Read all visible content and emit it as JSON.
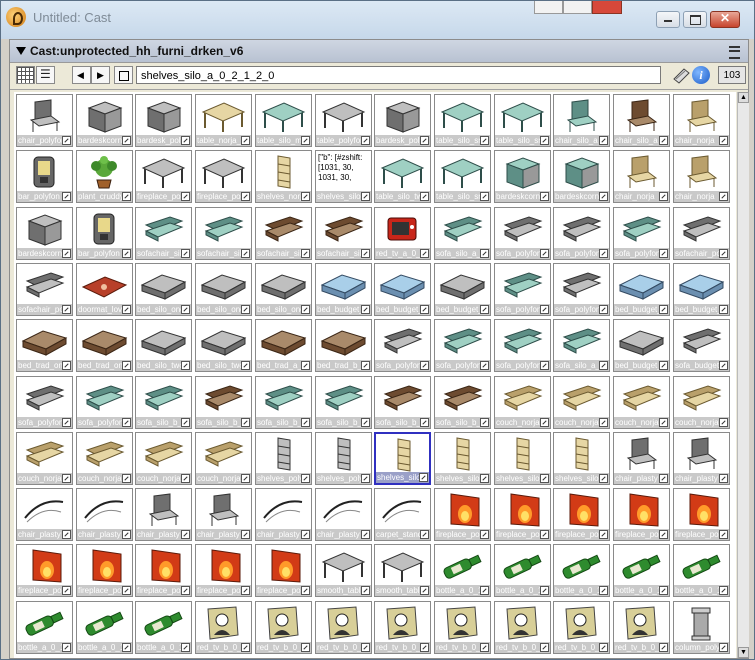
{
  "window": {
    "title": "Untitled: Cast"
  },
  "panel": {
    "title": "Cast:unprotected_hh_furni_drken_v6"
  },
  "toolbar": {
    "member_name": "shelves_silo_a_0_2_1_2_0",
    "member_number": "103"
  },
  "colors": {
    "accent": "#3030c0",
    "wood": "#c8a070",
    "fire": "#d23b16",
    "bottle": "#2e8b2e"
  },
  "cells": [
    {
      "label": "chair_polyfon",
      "icon": "chair-icon",
      "kind": "dark"
    },
    {
      "label": "bardeskcorne",
      "icon": "desk-icon",
      "kind": "dark"
    },
    {
      "label": "bardesk_poly",
      "icon": "desk-icon",
      "kind": "dark"
    },
    {
      "label": "table_norja_m",
      "icon": "table-icon",
      "kind": "wood"
    },
    {
      "label": "table_silo_me",
      "icon": "table-icon",
      "kind": "teal"
    },
    {
      "label": "table_polyfon",
      "icon": "table-icon",
      "kind": "dark"
    },
    {
      "label": "bardesk_polyf",
      "icon": "desk-icon",
      "kind": "dark"
    },
    {
      "label": "table_silo_sm",
      "icon": "table-icon",
      "kind": "teal"
    },
    {
      "label": "table_silo_sm",
      "icon": "table-icon",
      "kind": "teal"
    },
    {
      "label": "chair_silo_a",
      "icon": "chair-icon",
      "kind": "teal"
    },
    {
      "label": "chair_silo_a",
      "icon": "chair-icon",
      "kind": "brown"
    },
    {
      "label": "chair_norja",
      "icon": "chair-icon",
      "kind": "wood"
    },
    {
      "label": "bar_polyfon",
      "icon": "bar-machine-icon",
      "kind": "dark"
    },
    {
      "label": "plant_cruddy",
      "icon": "plant-icon",
      "kind": "plant"
    },
    {
      "label": "fireplace_poly",
      "icon": "fireplace-icon",
      "kind": "dark"
    },
    {
      "label": "fireplace_poly",
      "icon": "fireplace-icon",
      "kind": "dark"
    },
    {
      "label": "shelves_norja",
      "icon": "shelf-icon",
      "kind": "wood"
    },
    {
      "label": "shelves_silo_b",
      "icon": "text-icon",
      "kind": "text",
      "text": "[\"b\": [#zshift: [1031, 30, 1031, 30,"
    },
    {
      "label": "table_silo_two",
      "icon": "table-icon",
      "kind": "teal"
    },
    {
      "label": "table_silo_sm",
      "icon": "table-icon",
      "kind": "teal"
    },
    {
      "label": "bardeskcorne",
      "icon": "desk-icon",
      "kind": "teal"
    },
    {
      "label": "bardeskcorne",
      "icon": "desk-icon",
      "kind": "teal"
    },
    {
      "label": "chair_norja",
      "icon": "chair-icon",
      "kind": "wood"
    },
    {
      "label": "chair_norja",
      "icon": "chair-icon",
      "kind": "wood"
    },
    {
      "label": "bardeskcorne",
      "icon": "desk-icon",
      "kind": "dark"
    },
    {
      "label": "bar_polyfon",
      "icon": "bar-machine-icon",
      "kind": "dark"
    },
    {
      "label": "sofachair_sil",
      "icon": "sofa-icon",
      "kind": "teal"
    },
    {
      "label": "sofachair_sil",
      "icon": "sofa-icon",
      "kind": "teal"
    },
    {
      "label": "sofachair_sil",
      "icon": "sofa-icon",
      "kind": "brown"
    },
    {
      "label": "sofachair_sil",
      "icon": "sofa-icon",
      "kind": "brown"
    },
    {
      "label": "red_tv_a_0_1",
      "icon": "tv-icon",
      "kind": "red"
    },
    {
      "label": "sofa_silo_a_0",
      "icon": "sofa-icon",
      "kind": "teal"
    },
    {
      "label": "sofa_polyfon",
      "icon": "sofa-icon",
      "kind": "dark"
    },
    {
      "label": "sofa_polyfon",
      "icon": "sofa-icon",
      "kind": "dark"
    },
    {
      "label": "sofa_polyfon",
      "icon": "sofa-icon",
      "kind": "teal"
    },
    {
      "label": "sofachair_poly",
      "icon": "sofa-icon",
      "kind": "dark"
    },
    {
      "label": "sofachair_poly",
      "icon": "sofa-icon",
      "kind": "dark"
    },
    {
      "label": "doormat_love",
      "icon": "doormat-icon",
      "kind": "red"
    },
    {
      "label": "bed_silo_one",
      "icon": "bed-icon",
      "kind": "dark"
    },
    {
      "label": "bed_silo_one",
      "icon": "bed-icon",
      "kind": "dark"
    },
    {
      "label": "bed_silo_one",
      "icon": "bed-icon",
      "kind": "dark"
    },
    {
      "label": "bed_budget_o",
      "icon": "bed-icon",
      "kind": "blue"
    },
    {
      "label": "bed_budget_o",
      "icon": "bed-icon",
      "kind": "blue"
    },
    {
      "label": "bed_budget_o",
      "icon": "bed-icon",
      "kind": "dark"
    },
    {
      "label": "sofa_polyfon",
      "icon": "sofa-icon",
      "kind": "teal"
    },
    {
      "label": "sofa_polyfon",
      "icon": "sofa-icon",
      "kind": "dark"
    },
    {
      "label": "bed_budget_o",
      "icon": "bed-icon",
      "kind": "blue"
    },
    {
      "label": "bed_budget_o",
      "icon": "bed-icon",
      "kind": "blue"
    },
    {
      "label": "bed_trad_one",
      "icon": "bed-icon",
      "kind": "brown"
    },
    {
      "label": "bed_trad_one",
      "icon": "bed-icon",
      "kind": "brown"
    },
    {
      "label": "bed_silo_two",
      "icon": "bed-icon",
      "kind": "dark"
    },
    {
      "label": "bed_silo_two",
      "icon": "bed-icon",
      "kind": "dark"
    },
    {
      "label": "bed_trad_a_0",
      "icon": "bed-icon",
      "kind": "brown"
    },
    {
      "label": "bed_trad_b_0",
      "icon": "bed-icon",
      "kind": "brown"
    },
    {
      "label": "sofa_polyfon",
      "icon": "sofa-icon",
      "kind": "dark"
    },
    {
      "label": "sofa_polyfon",
      "icon": "sofa-icon",
      "kind": "teal"
    },
    {
      "label": "sofa_polyfon",
      "icon": "sofa-icon",
      "kind": "teal"
    },
    {
      "label": "sofa_silo_a_0",
      "icon": "sofa-icon",
      "kind": "teal"
    },
    {
      "label": "bed_budget_o",
      "icon": "bed-icon",
      "kind": "dark"
    },
    {
      "label": "sofa_budget_o",
      "icon": "sofa-icon",
      "kind": "dark"
    },
    {
      "label": "sofa_polyfon",
      "icon": "sofa-icon",
      "kind": "dark"
    },
    {
      "label": "sofa_polyfon",
      "icon": "sofa-icon",
      "kind": "teal"
    },
    {
      "label": "sofa_silo_b_0",
      "icon": "sofa-icon",
      "kind": "teal"
    },
    {
      "label": "sofa_silo_b_0",
      "icon": "sofa-icon",
      "kind": "brown"
    },
    {
      "label": "sofa_silo_b_0",
      "icon": "sofa-icon",
      "kind": "teal"
    },
    {
      "label": "sofa_silo_b_0",
      "icon": "sofa-icon",
      "kind": "teal"
    },
    {
      "label": "sofa_silo_b_0",
      "icon": "sofa-icon",
      "kind": "brown"
    },
    {
      "label": "sofa_silo_b_0",
      "icon": "sofa-icon",
      "kind": "brown"
    },
    {
      "label": "couch_norja",
      "icon": "couch-icon",
      "kind": "wood"
    },
    {
      "label": "couch_norja",
      "icon": "couch-icon",
      "kind": "wood"
    },
    {
      "label": "couch_norja",
      "icon": "couch-icon",
      "kind": "wood"
    },
    {
      "label": "couch_norja",
      "icon": "couch-icon",
      "kind": "wood"
    },
    {
      "label": "couch_norja",
      "icon": "couch-icon",
      "kind": "wood"
    },
    {
      "label": "couch_norja",
      "icon": "couch-icon",
      "kind": "wood"
    },
    {
      "label": "couch_norja",
      "icon": "couch-icon",
      "kind": "wood"
    },
    {
      "label": "couch_norja",
      "icon": "couch-icon",
      "kind": "wood"
    },
    {
      "label": "shelves_poly",
      "icon": "shelf-icon",
      "kind": "dark"
    },
    {
      "label": "shelves_poly",
      "icon": "shelf-icon",
      "kind": "dark"
    },
    {
      "label": "shelves_silo",
      "icon": "shelf-icon",
      "kind": "wood",
      "selected": true
    },
    {
      "label": "shelves_silo",
      "icon": "shelf-icon",
      "kind": "wood"
    },
    {
      "label": "shelves_silo",
      "icon": "shelf-icon",
      "kind": "wood"
    },
    {
      "label": "shelves_silo",
      "icon": "shelf-icon",
      "kind": "wood"
    },
    {
      "label": "chair_plasty",
      "icon": "chair-icon",
      "kind": "dark"
    },
    {
      "label": "chair_plasty",
      "icon": "chair-icon",
      "kind": "dark"
    },
    {
      "label": "chair_plasty",
      "icon": "chair-outline-icon",
      "kind": "outline"
    },
    {
      "label": "chair_plasty",
      "icon": "chair-outline-icon",
      "kind": "outline"
    },
    {
      "label": "chair_plasty",
      "icon": "chair-icon",
      "kind": "dark"
    },
    {
      "label": "chair_plasty",
      "icon": "chair-icon",
      "kind": "dark"
    },
    {
      "label": "chair_plasty",
      "icon": "chair-outline-icon",
      "kind": "outline"
    },
    {
      "label": "chair_plasty",
      "icon": "chair-outline-icon",
      "kind": "outline"
    },
    {
      "label": "carpet_standa",
      "icon": "carpet-icon",
      "kind": "outline"
    },
    {
      "label": "fireplace_poly",
      "icon": "fireplace-icon",
      "kind": "fire"
    },
    {
      "label": "fireplace_poly",
      "icon": "fireplace-icon",
      "kind": "fire"
    },
    {
      "label": "fireplace_poly",
      "icon": "fireplace-icon",
      "kind": "fire"
    },
    {
      "label": "fireplace_poly",
      "icon": "fireplace-icon",
      "kind": "fire"
    },
    {
      "label": "fireplace_poly",
      "icon": "fireplace-icon",
      "kind": "fire"
    },
    {
      "label": "fireplace_poly",
      "icon": "fireplace-icon",
      "kind": "fire"
    },
    {
      "label": "fireplace_poly",
      "icon": "fireplace-icon",
      "kind": "fire"
    },
    {
      "label": "fireplace_poly",
      "icon": "fireplace-icon",
      "kind": "fire"
    },
    {
      "label": "fireplace_poly",
      "icon": "fireplace-icon",
      "kind": "fire"
    },
    {
      "label": "fireplace_poly",
      "icon": "fireplace-icon",
      "kind": "fire"
    },
    {
      "label": "smooth_table",
      "icon": "table-icon",
      "kind": "dark"
    },
    {
      "label": "smooth_table",
      "icon": "table-icon",
      "kind": "dark"
    },
    {
      "label": "bottle_a_0_1",
      "icon": "bottle-icon",
      "kind": "bottle"
    },
    {
      "label": "bottle_a_0_1",
      "icon": "bottle-icon",
      "kind": "bottle"
    },
    {
      "label": "bottle_a_0_1",
      "icon": "bottle-icon",
      "kind": "bottle"
    },
    {
      "label": "bottle_a_0_1",
      "icon": "bottle-icon",
      "kind": "bottle"
    },
    {
      "label": "bottle_a_0_1",
      "icon": "bottle-icon",
      "kind": "bottle"
    },
    {
      "label": "bottle_a_0_1",
      "icon": "bottle-icon",
      "kind": "bottle"
    },
    {
      "label": "bottle_a_0_1",
      "icon": "bottle-icon",
      "kind": "bottle"
    },
    {
      "label": "bottle_a_0_1",
      "icon": "bottle-icon",
      "kind": "bottle"
    },
    {
      "label": "red_tv_b_0_1",
      "icon": "tv-screen-icon",
      "kind": "screen"
    },
    {
      "label": "red_tv_b_0_1",
      "icon": "tv-screen-icon",
      "kind": "screen"
    },
    {
      "label": "red_tv_b_0_1",
      "icon": "tv-screen-icon",
      "kind": "screen"
    },
    {
      "label": "red_tv_b_0_1",
      "icon": "tv-screen-icon",
      "kind": "screen"
    },
    {
      "label": "red_tv_b_0_1",
      "icon": "tv-screen-icon",
      "kind": "screen"
    },
    {
      "label": "red_tv_b_0_1",
      "icon": "tv-screen-icon",
      "kind": "screen"
    },
    {
      "label": "red_tv_b_0_1",
      "icon": "tv-screen-icon",
      "kind": "screen"
    },
    {
      "label": "red_tv_b_0_1",
      "icon": "tv-screen-icon",
      "kind": "screen"
    },
    {
      "label": "column_poly",
      "icon": "column-icon",
      "kind": "dark"
    }
  ]
}
